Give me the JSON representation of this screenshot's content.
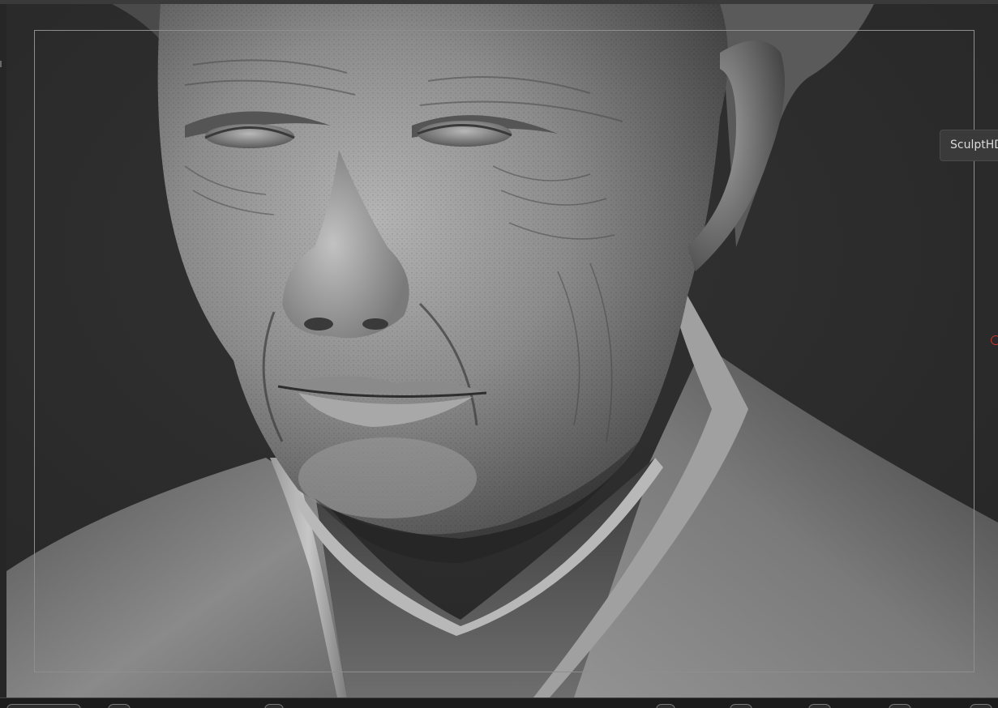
{
  "viewport": {
    "tooltip_label": "SculptHD",
    "background_color": "#2c2c2c",
    "model_color": "#8a8a8a"
  },
  "icons": {
    "cursor": "brush-cursor-icon"
  }
}
